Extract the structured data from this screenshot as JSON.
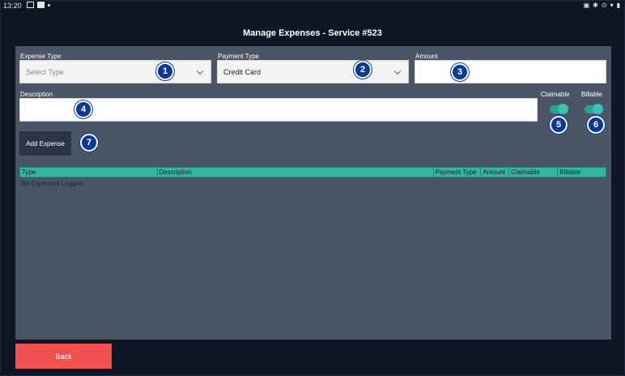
{
  "status_bar": {
    "time": "13:20"
  },
  "page": {
    "title": "Manage Expenses  -  Service #523"
  },
  "form": {
    "expense_type": {
      "label": "Expense Type",
      "placeholder": "Select Type"
    },
    "payment_type": {
      "label": "Payment Type",
      "value": "Credit Card"
    },
    "amount": {
      "label": "Amount",
      "value": ""
    },
    "description": {
      "label": "Description",
      "value": ""
    },
    "claimable": {
      "label": "Claimable",
      "on": true
    },
    "billable": {
      "label": "Billable",
      "on": true
    },
    "add_button": "Add Expense"
  },
  "badges": [
    "1",
    "2",
    "3",
    "4",
    "5",
    "6",
    "7"
  ],
  "table": {
    "columns": [
      "Type",
      "Description",
      "Payment Type",
      "Amount",
      "Claimable",
      "Billable"
    ],
    "empty_message": "No Expenses Logged"
  },
  "footer": {
    "back_button": "Back"
  },
  "colors": {
    "background": "#0f1623",
    "panel": "#4a5567",
    "accent_teal": "#35b3a4",
    "toggle_on": "#2aa39a",
    "back_button": "#f05252",
    "badge": "#0b3a93"
  }
}
